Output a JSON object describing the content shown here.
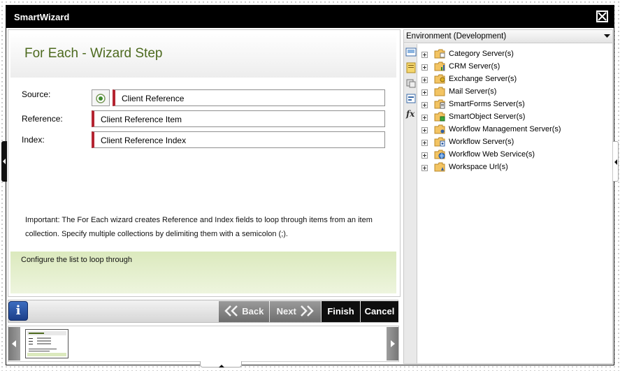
{
  "window": {
    "title": "SmartWizard"
  },
  "wizard": {
    "step_title": "For Each - Wizard Step",
    "fields": [
      {
        "label": "Source:",
        "value": "Client Reference"
      },
      {
        "label": "Reference:",
        "value": "Client Reference Item"
      },
      {
        "label": "Index:",
        "value": "Client Reference Index"
      }
    ],
    "info_text": "Important: The For Each wizard creates Reference and Index fields to loop through items from an item collection. Specify multiple collections by delimiting them with a semicolon (;).",
    "hint_text": "Configure the list to loop through"
  },
  "nav": {
    "info_label": "i",
    "back_label": "Back",
    "next_label": "Next",
    "finish_label": "Finish",
    "cancel_label": "Cancel"
  },
  "environment": {
    "title": "Environment (Development)",
    "tree_items": [
      {
        "label": "Category Server(s)",
        "icon": "folder-category-icon"
      },
      {
        "label": "CRM Server(s)",
        "icon": "folder-crm-icon"
      },
      {
        "label": "Exchange Server(s)",
        "icon": "folder-exchange-icon"
      },
      {
        "label": "Mail Server(s)",
        "icon": "folder-mail-icon"
      },
      {
        "label": "SmartForms Server(s)",
        "icon": "folder-smartforms-icon"
      },
      {
        "label": "SmartObject Server(s)",
        "icon": "folder-smartobject-icon"
      },
      {
        "label": "Workflow Management Server(s)",
        "icon": "folder-workflow-management-icon"
      },
      {
        "label": "Workflow Server(s)",
        "icon": "folder-workflow-icon"
      },
      {
        "label": "Workflow Web Service(s)",
        "icon": "folder-workflow-web-service-icon"
      },
      {
        "label": "Workspace Url(s)",
        "icon": "folder-workspace-icon"
      }
    ],
    "toolbar_icons": [
      "environment-icon",
      "context-icon",
      "objects-icon",
      "form-icon",
      "function-icon"
    ]
  },
  "colors": {
    "title_bar": "#000000",
    "step_title": "#4d6a1f",
    "required_marker": "#b52431",
    "hint_background": "#dbe9bd",
    "info_button": "#2a55a8"
  }
}
